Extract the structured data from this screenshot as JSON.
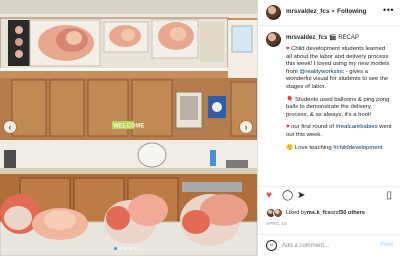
{
  "header": {
    "username": "mrsvaldez_fcs",
    "separator": "•",
    "follow_label": "Following",
    "more_label": "•••"
  },
  "media": {
    "prev_label": "‹",
    "next_label": "›",
    "slide_count": 5,
    "active_slide": 1,
    "wall_sign": "WELCOME"
  },
  "caption": {
    "username": "mrsvaldez_fcs",
    "recap_emoji": "🎬",
    "recap_label": "RECAP",
    "p1_heart": "♥",
    "p1_text_a": " Child development students learned all about the labor and delivery process this week! I loved using my new models from ",
    "p1_link": "@realityworksinc",
    "p1_text_b": " - gives a wonderful visual for students to see the stages of labor.",
    "p2_emoji": "🎈",
    "p2_text": " Students used balloons & ping pong balls to demonstrate the delivery process, & as always, it's a hoot!",
    "p3_heart": "♥",
    "p3_text_a": " our first round of ",
    "p3_link": "#realcarebabies",
    "p3_text_b": " went out this week.",
    "p4_emoji": "🙂",
    "p4_text": " Love teaching ",
    "p4_link": "#childdevelopment"
  },
  "actions": {
    "like_icon": "♥",
    "comment_icon": "◯",
    "share_icon": "➤",
    "save_icon": "▯"
  },
  "likes": {
    "prefix": "Liked by ",
    "user": "ms.k_fcs",
    "middle": " and ",
    "others": "50 others"
  },
  "date": "APRIL 19",
  "comment": {
    "emoji_icon": "☺",
    "placeholder": "Add a comment...",
    "post_label": "Post"
  },
  "colors": {
    "like_red": "#ed4956",
    "link_blue": "#00376b",
    "post_disabled": "#b3dbff",
    "cabinet_wood": "#b57c4d"
  }
}
